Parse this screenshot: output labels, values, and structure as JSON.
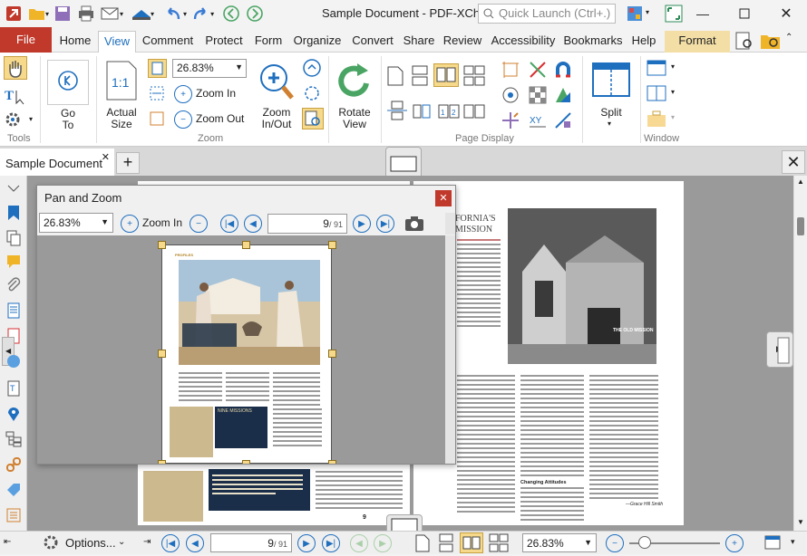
{
  "window": {
    "title": "Sample Document - PDF-XCha...",
    "quick_launch_placeholder": "Quick Launch (Ctrl+.)"
  },
  "menu": {
    "file": "File",
    "items": [
      "Home",
      "View",
      "Comment",
      "Protect",
      "Form",
      "Organize",
      "Convert",
      "Share",
      "Review",
      "Accessibility",
      "Bookmarks",
      "Help",
      "Format"
    ]
  },
  "ribbon": {
    "tools_label": "Tools",
    "zoom_label": "Zoom",
    "page_display_label": "Page Display",
    "window_label": "Window",
    "go_to": "Go\nTo",
    "actual_size": "Actual\nSize",
    "zoom_value": "26.83%",
    "zoom_in": "Zoom In",
    "zoom_out": "Zoom Out",
    "zoom_in_out": "Zoom\nIn/Out",
    "rotate_view": "Rotate\nView",
    "split": "Split"
  },
  "tabs": {
    "doc_tab": "Sample Document"
  },
  "pan_zoom": {
    "title": "Pan and Zoom",
    "zoom_value": "26.83%",
    "zoom_in": "Zoom In",
    "page_current": "9",
    "page_total": "/ 91"
  },
  "page_content": {
    "heading_line1": "FORNIA'S",
    "heading_line2": "MISSION",
    "photo_caption": "THE OLD MISSION",
    "section_head": "Changing Attitudes",
    "quote_credit": "—Grace Hill Smith",
    "thumb_box_title": "NINE MISSIONS",
    "thumb_label": "PROFILES"
  },
  "status": {
    "options": "Options...",
    "page_current": "9",
    "page_total": "/ 91",
    "zoom_value": "26.83%"
  }
}
